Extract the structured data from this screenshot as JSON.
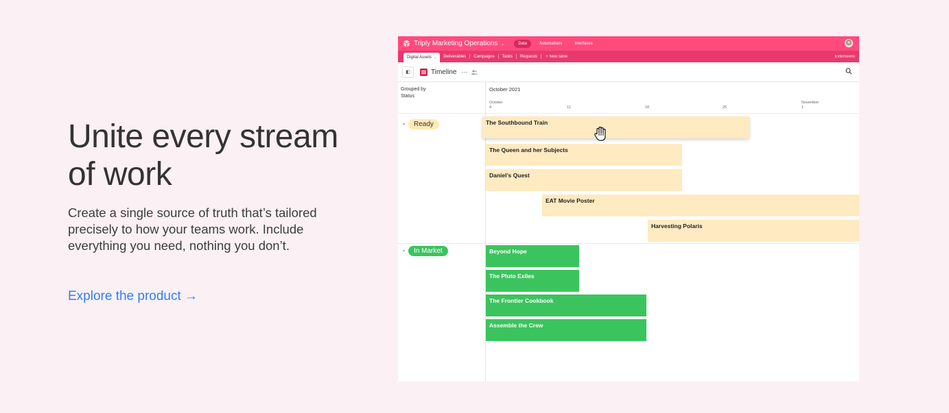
{
  "hero": {
    "title": "Unite every stream of work",
    "description": "Create a single source of truth that’s tailored precisely to how your teams work. Include everything you need, nothing you don’t.",
    "cta": "Explore the product →"
  },
  "app": {
    "base_name": "Triply Marketing Operations",
    "nav": [
      "Data",
      "Automations",
      "Interfaces"
    ],
    "tables": [
      "Digital Assets",
      "Deliverables",
      "Campaigns",
      "Tasks",
      "Requests"
    ],
    "new_table": "+ New table",
    "extensions": "Extensions",
    "view_name": "Timeline",
    "grouped_by": "Grouped by",
    "grouped_field": "Status",
    "month": "October 2021",
    "ticks": [
      {
        "top": "October",
        "bottom": "4"
      },
      {
        "top": "",
        "bottom": "11"
      },
      {
        "top": "",
        "bottom": "18"
      },
      {
        "top": "",
        "bottom": "25"
      },
      {
        "top": "November",
        "bottom": "1"
      }
    ],
    "groups": [
      {
        "name": "Ready",
        "color": "#ffeab6",
        "text_color": "#333333"
      },
      {
        "name": "In Market",
        "color": "#20c933",
        "text_color": "#ffffff"
      }
    ],
    "records": [
      "The Southbound Train",
      "The Queen and her Subjects",
      "Daniel’s Quest",
      "EAT Movie Poster",
      "Harvesting Polaris",
      "Beyond Hope",
      "The Pluto Exiles",
      "The Frontier Cookbook",
      "Assemble the Crew"
    ]
  },
  "icons": {
    "logo": "airtable-logo-icon",
    "search": "search-icon",
    "cursor": "grab-hand-cursor-icon"
  }
}
